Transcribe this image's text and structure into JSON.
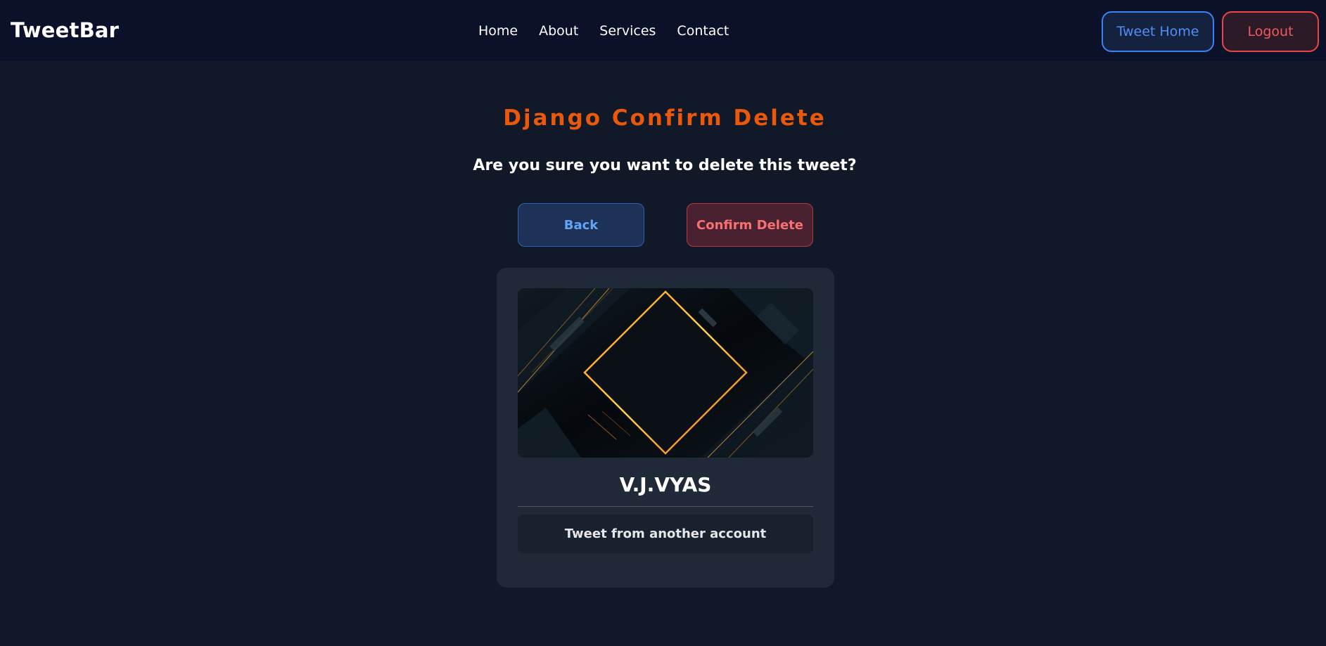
{
  "navbar": {
    "brand": "TweetBar",
    "links": [
      "Home",
      "About",
      "Services",
      "Contact"
    ],
    "tweet_home_label": "Tweet Home",
    "logout_label": "Logout"
  },
  "main": {
    "title": "Django Confirm Delete",
    "question": "Are you sure you want to delete this tweet?",
    "back_label": "Back",
    "confirm_label": "Confirm Delete"
  },
  "tweet_card": {
    "username": "V.J.VYAS",
    "text": "Tweet from another account",
    "image_icon": "abstract-diamond-image"
  },
  "colors": {
    "background": "#111827",
    "navbar": "#0b1128",
    "accent_orange": "#ea580c",
    "blue": "#3b82f6",
    "red": "#ef4444"
  }
}
